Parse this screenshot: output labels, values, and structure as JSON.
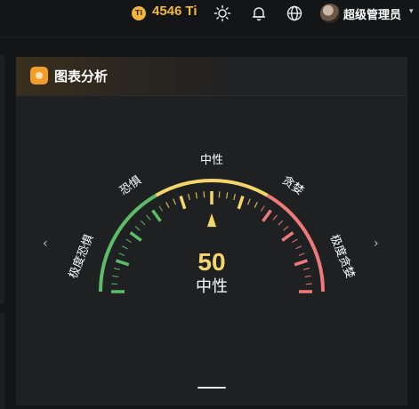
{
  "topbar": {
    "coin_symbol": "Ti",
    "balance": "4546 Ti",
    "icons": [
      "sun-icon",
      "bell-icon",
      "globe-icon"
    ],
    "username": "超级管理员",
    "caret": "▾"
  },
  "card": {
    "title": "图表分析"
  },
  "gauge": {
    "value": 50,
    "max": 100,
    "status": "中性",
    "labels": {
      "extreme_fear": "极度恐惧",
      "fear": "恐惧",
      "neutral": "中性",
      "greed": "贪婪",
      "extreme_greed": "极度贪婪"
    },
    "colors": {
      "fear": "#5cbd68",
      "neutral": "#f5d66a",
      "greed": "#f07a79",
      "value_text": "#f5d66a"
    }
  },
  "carousel": {
    "prev": "‹",
    "next": "›"
  }
}
